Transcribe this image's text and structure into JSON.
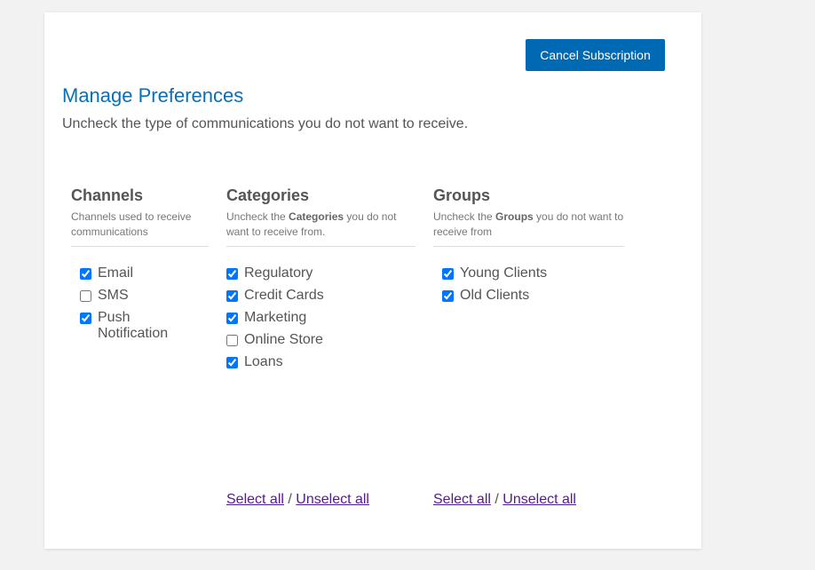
{
  "header": {
    "cancel_button_label": "Cancel Subscription",
    "title": "Manage Preferences",
    "subtitle": "Uncheck the type of communications you do not want to receive."
  },
  "colors": {
    "accent": "#0069b4",
    "title": "#0a6fb5",
    "link": "#551a8b",
    "background": "#f2f2f2"
  },
  "channels": {
    "heading": "Channels",
    "description": "Channels used to receive communications",
    "items": [
      {
        "label": "Email",
        "checked": true
      },
      {
        "label": "SMS",
        "checked": false
      },
      {
        "label": "Push Notification",
        "checked": true
      }
    ]
  },
  "categories": {
    "heading": "Categories",
    "description_pre": "Uncheck the ",
    "description_bold": "Categories",
    "description_post": " you do not want to receive from.",
    "items": [
      {
        "label": "Regulatory",
        "checked": true
      },
      {
        "label": "Credit Cards",
        "checked": true
      },
      {
        "label": "Marketing",
        "checked": true
      },
      {
        "label": "Online Store",
        "checked": false
      },
      {
        "label": "Loans",
        "checked": true
      }
    ],
    "select_all": "Select all",
    "separator": "/",
    "unselect_all": "Unselect all"
  },
  "groups": {
    "heading": "Groups",
    "description_pre": "Uncheck the ",
    "description_bold": "Groups",
    "description_post": " you do not want to receive from",
    "items": [
      {
        "label": "Young Clients",
        "checked": true
      },
      {
        "label": "Old Clients",
        "checked": true
      }
    ],
    "select_all": "Select all",
    "separator": "/",
    "unselect_all": "Unselect all"
  }
}
